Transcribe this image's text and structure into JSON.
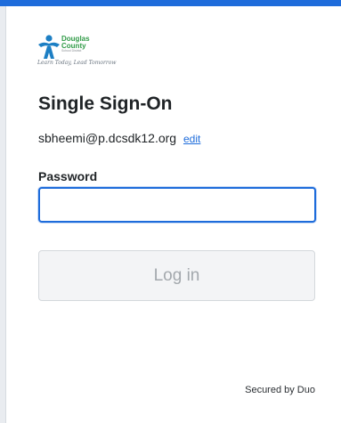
{
  "brand": {
    "logo_line1": "Douglas",
    "logo_line2": "County",
    "logo_line3": "School District",
    "tagline": "Learn Today, Lead Tomorrow",
    "accent_color": "#1e6cdb",
    "logo_blue": "#1d7fc4",
    "logo_green": "#2f9a46"
  },
  "page": {
    "title": "Single Sign-On",
    "username": "sbheemi@p.dcsdk12.org",
    "edit_label": "edit"
  },
  "form": {
    "password_label": "Password",
    "password_value": "",
    "login_label": "Log in"
  },
  "footer": {
    "secured_text": "Secured by Duo"
  }
}
